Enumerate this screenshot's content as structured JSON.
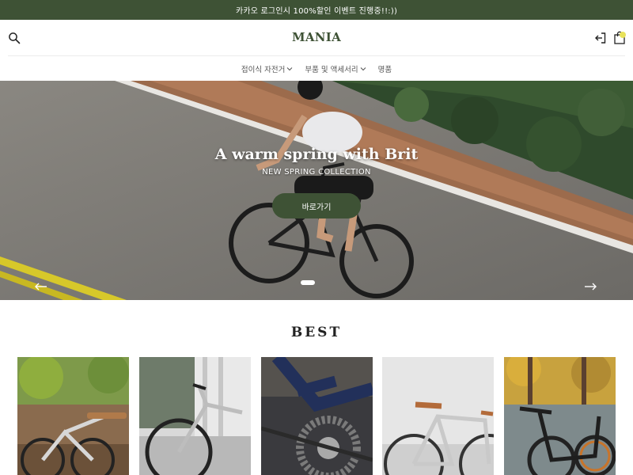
{
  "announcement": "카카오 로그인시 100%할인 이벤트 진행중!!:))",
  "header": {
    "logo": "MANIA",
    "icons": {
      "search": "search-icon",
      "login": "login-icon",
      "cart": "shopping-bag-icon"
    }
  },
  "nav": {
    "items": [
      {
        "label": "접이식 자전거",
        "has_dropdown": true
      },
      {
        "label": "부품 및 액세서리",
        "has_dropdown": true
      },
      {
        "label": "명품",
        "has_dropdown": false
      }
    ]
  },
  "hero": {
    "title": "A warm spring with Brit",
    "subtitle": "NEW SPRING COLLECTION",
    "button_label": "바로가기",
    "prev_icon": "arrow-left-icon",
    "next_icon": "arrow-right-icon"
  },
  "best": {
    "title": "BEST"
  },
  "colors": {
    "brand": "#3e5235",
    "cart_badge": "#e8e25a"
  }
}
